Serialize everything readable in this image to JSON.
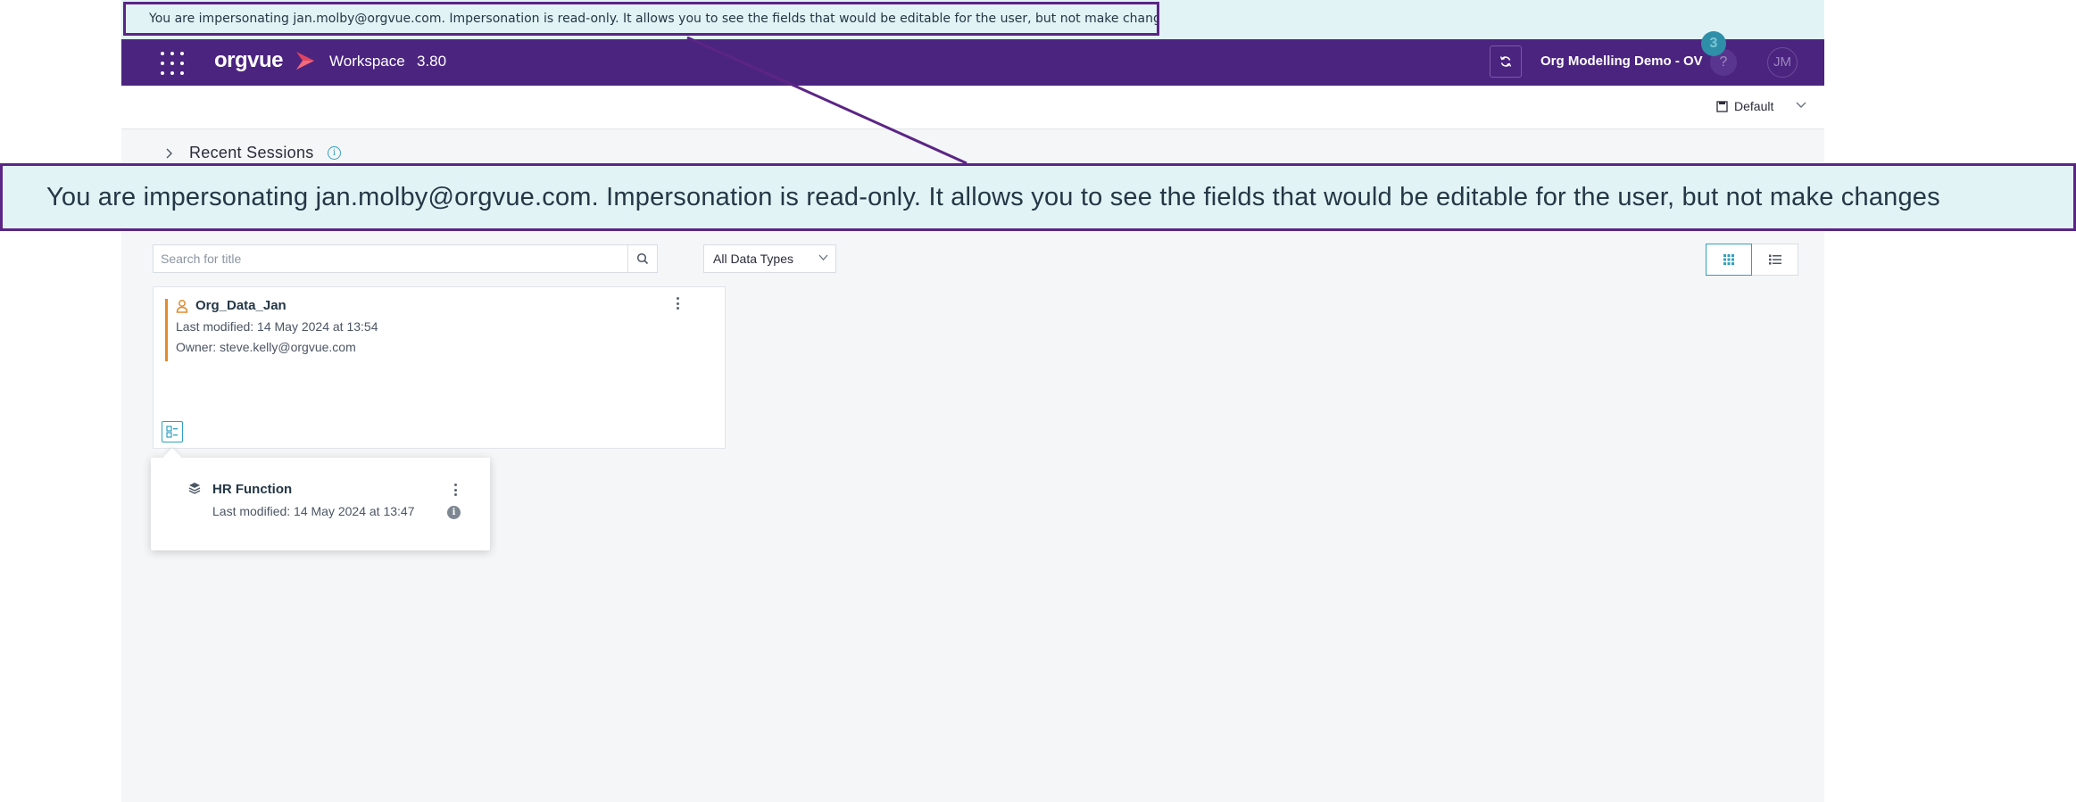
{
  "banner": {
    "impersonation_text": "You are impersonating jan.molby@orgvue.com. Impersonation is read-only. It allows you to see the fields that would be editable for the user, but not make changes"
  },
  "topnav": {
    "logo_text": "orgvue",
    "workspace_label": "Workspace",
    "version": "3.80",
    "org_name": "Org Modelling Demo - OV",
    "notification_count": "3",
    "help_label": "?",
    "avatar_initials": "JM"
  },
  "subbar": {
    "view_label": "Default"
  },
  "recent_sessions": {
    "label": "Recent Sessions",
    "info_glyph": "i"
  },
  "zoom_callout": {
    "text": "You are impersonating jan.molby@orgvue.com. Impersonation is read-only. It allows you to see the fields that would be editable for the user, but not make changes"
  },
  "filters": {
    "search_placeholder": "Search for title",
    "data_type_selected": "All Data Types"
  },
  "card": {
    "title": "Org_Data_Jan",
    "last_modified": "Last modified: 14 May 2024 at 13:54",
    "owner": "Owner: steve.kelly@orgvue.com"
  },
  "popover": {
    "title": "HR Function",
    "last_modified": "Last modified: 14 May 2024 at 13:47",
    "info_glyph": "i"
  },
  "colors": {
    "nav_purple": "#4b2480",
    "accent_teal": "#2fa0bd",
    "banner_bg": "#e2f3f5",
    "callout_border": "#5b2585",
    "card_accent_orange": "#e08b2e"
  }
}
